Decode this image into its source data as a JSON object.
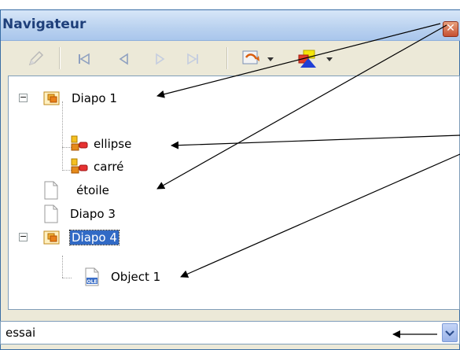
{
  "window": {
    "title": "Navigateur"
  },
  "toolbar": {
    "items": [
      {
        "icon": "pencil-icon"
      },
      {
        "icon": "first-slide-icon"
      },
      {
        "icon": "previous-slide-icon"
      },
      {
        "icon": "next-slide-icon"
      },
      {
        "icon": "last-slide-icon"
      },
      {
        "icon": "drag-mode-icon"
      },
      {
        "icon": "shapes-icon"
      }
    ]
  },
  "tree": {
    "items": [
      {
        "label": "Diapo 1",
        "icon": "slide-icon",
        "expanded": true
      },
      {
        "label": "ellipse",
        "icon": "shape-object-icon"
      },
      {
        "label": "carré",
        "icon": "shape-object-icon"
      },
      {
        "label": "étoile",
        "icon": "page-icon"
      },
      {
        "label": "Diapo 3",
        "icon": "page-icon"
      },
      {
        "label": "Diapo 4",
        "icon": "slide-icon",
        "expanded": true,
        "selected": true
      },
      {
        "label": "Object 1",
        "icon": "ole-object-icon"
      }
    ]
  },
  "document_select": {
    "value": "essai"
  }
}
